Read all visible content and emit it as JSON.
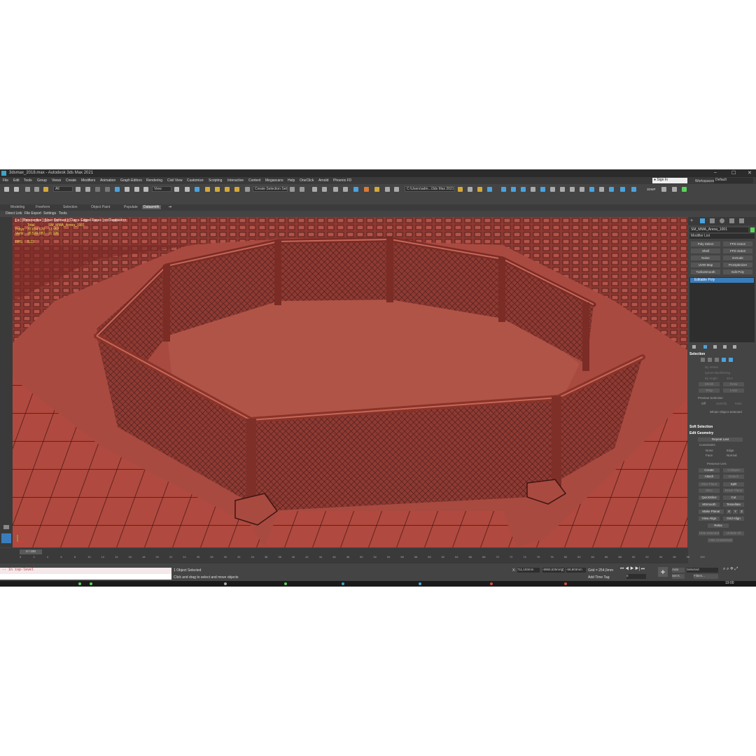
{
  "window": {
    "title": "3dsmax_2018.max - Autodesk 3ds Max 2021",
    "minimize": "–",
    "maximize": "☐",
    "close": "✕"
  },
  "menu": [
    "File",
    "Edit",
    "Tools",
    "Group",
    "Views",
    "Create",
    "Modifiers",
    "Animation",
    "Graph Editors",
    "Rendering",
    "Civil View",
    "Customize",
    "Scripting",
    "Interactive",
    "Content",
    "Megascans",
    "Help",
    "OneClick",
    "Arnold",
    "Phoenix FD"
  ],
  "signin": {
    "label": "Sign In"
  },
  "workspaces": {
    "label": "Workspaces:",
    "value": "Default"
  },
  "toolbar": {
    "filter_value": "All",
    "view_value": "View",
    "selection_set": "Create Selection Set",
    "path_value": "C:\\Users\\adm...\\3ds Max 2021",
    "label_right": "3DMP"
  },
  "ribbon": {
    "tabs": [
      "Modeling",
      "Freeform",
      "Selection",
      "Object Paint",
      "Populate",
      "Datasmith"
    ],
    "active": "Datasmith"
  },
  "subbar": [
    "Direct Link",
    "File Export",
    "Settings",
    "Tools"
  ],
  "viewport": {
    "label": "[ + ] [Perspective ] [User Defined ] [Clay + Edged Faces ] <<Disabled>>",
    "stats": {
      "total_label": "Total",
      "object_name": "SM_MMA_Arena_1001",
      "polys_label": "Polys:",
      "polys_total": "37 654 676",
      "polys_sel": "13 952",
      "verts_label": "Verts:",
      "verts_total": "35 539 087",
      "verts_sel": "11 226",
      "fps_label": "FPS:",
      "fps": "5,23"
    }
  },
  "command_panel": {
    "object_name": "SM_MMA_Arena_1001",
    "modifier_list": "Modifier List",
    "modifier_buttons": [
      "Poly Select",
      "FFD 2x2x2",
      "Shell",
      "FFD 3x3x3",
      "Noise",
      "Extrude",
      "UVW Map",
      "ProOptimizer",
      "TurboSmooth",
      "Edit Poly"
    ],
    "stack_item": "Editable Poly",
    "selection": {
      "title": "Selection",
      "by_vertex": "By Vertex",
      "ignore_backfacing": "Ignore Backfacing",
      "by_angle": "By Angle:",
      "by_angle_value": "45,0",
      "shrink": "Shrink",
      "grow": "Grow",
      "ring": "Ring",
      "loop": "Loop",
      "preview": "Preview Selection",
      "off": "Off",
      "subobj": "SubObj",
      "multi": "Multi",
      "status": "Whole Object Selected"
    },
    "soft_selection": {
      "title": "Soft Selection"
    },
    "edit_geometry": {
      "title": "Edit Geometry",
      "repeat_last": "Repeat Last",
      "constraints": "Constraints",
      "none": "None",
      "edge": "Edge",
      "face": "Face",
      "normal": "Normal",
      "preserve_uvs": "Preserve UVs",
      "create": "Create",
      "collapse": "Collapse",
      "attach": "Attach",
      "detach": "Detach",
      "slice_plane": "Slice Plane",
      "split": "Split",
      "slice": "Slice",
      "reset_plane": "Reset Plane",
      "quickslice": "QuickSlice",
      "cut": "Cut",
      "msmooth": "MSmooth",
      "tessellate": "Tessellate",
      "make_planar": "Make Planar",
      "x": "X",
      "y": "Y",
      "z": "Z",
      "view_align": "View Align",
      "grid_align": "Grid Align",
      "relax": "Relax",
      "hide_selected": "Hide Selected",
      "unhide_all": "Unhide All",
      "hide_unselected": "Hide Unselected"
    }
  },
  "timeline": {
    "frame": "0 / 100",
    "ticks": [
      "0",
      "2",
      "4",
      "6",
      "8",
      "10",
      "12",
      "14",
      "16",
      "18",
      "20",
      "22",
      "24",
      "26",
      "28",
      "30",
      "32",
      "34",
      "36",
      "38",
      "40",
      "42",
      "44",
      "46",
      "48",
      "50",
      "52",
      "54",
      "56",
      "58",
      "60",
      "62",
      "64",
      "66",
      "68",
      "70",
      "72",
      "74",
      "76",
      "78",
      "80",
      "82",
      "84",
      "86",
      "88",
      "90",
      "92",
      "94",
      "96",
      "98",
      "100"
    ]
  },
  "status": {
    "maxscript": "-- In top-level",
    "selected": "1 Object Selected",
    "prompt": "Click and drag to select and move objects",
    "x_label": "X:",
    "x_value": "711,193mm",
    "y_value": "-8950,525mm",
    "z_label": "Z:",
    "z_value": "-58,803mm",
    "grid": "Grid = 254,0mm",
    "add_time_tag": "Add Time Tag",
    "auto": "Auto",
    "set_key": "Set K.",
    "key_mode": "Selected",
    "filters": "Filters...",
    "frame_num": "0",
    "clock": "19:00"
  },
  "colors": {
    "viewport_bg": "#a94a40",
    "cage_floor": "#b05447",
    "ui_dark": "#444444",
    "accent": "#3a7dbd"
  }
}
